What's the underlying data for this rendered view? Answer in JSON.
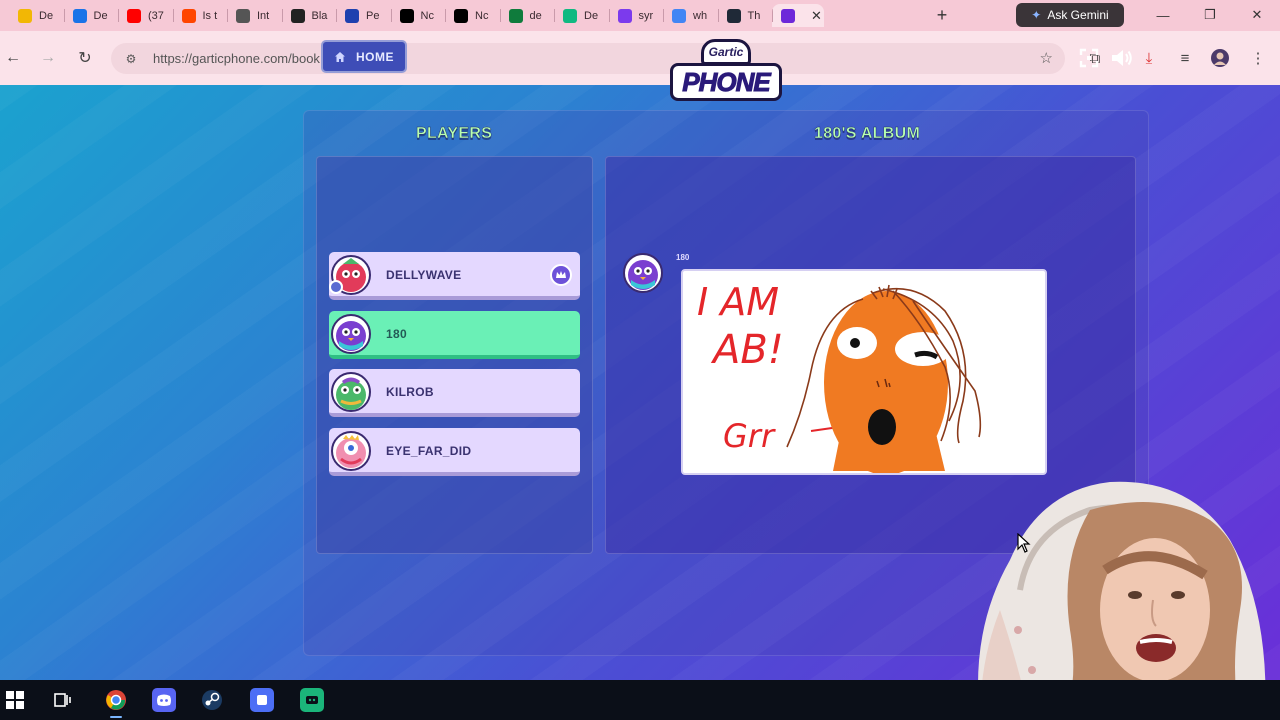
{
  "browser": {
    "tabs": [
      {
        "label": "De",
        "icon": "google-drive-icon",
        "color": "#f2b705"
      },
      {
        "label": "De",
        "icon": "google-drive-icon",
        "color": "#1a73e8"
      },
      {
        "label": "(37",
        "icon": "youtube-icon",
        "color": "#ff0000"
      },
      {
        "label": "Is t",
        "icon": "reddit-icon",
        "color": "#ff4500"
      },
      {
        "label": "Int",
        "icon": "globe-icon",
        "color": "#555555"
      },
      {
        "label": "Bla",
        "icon": "wix-icon",
        "color": "#222222"
      },
      {
        "label": "Pe",
        "icon": "pe-icon",
        "color": "#1e40af"
      },
      {
        "label": "Nc",
        "icon": "x-icon",
        "color": "#000000"
      },
      {
        "label": "Nc",
        "icon": "x-icon",
        "color": "#000000"
      },
      {
        "label": "de",
        "icon": "green-doc-icon",
        "color": "#0f7b3c"
      },
      {
        "label": "De",
        "icon": "k-icon",
        "color": "#10b981"
      },
      {
        "label": "syr",
        "icon": "peace-icon",
        "color": "#7c3aed"
      },
      {
        "label": "wh",
        "icon": "google-icon",
        "color": "#4285f4"
      },
      {
        "label": "Th",
        "icon": "dark-icon",
        "color": "#1f2937"
      },
      {
        "label": "",
        "icon": "gartic-icon",
        "color": "#6d28d9"
      }
    ],
    "gemini_label": "Ask Gemini",
    "url": "https://garticphone.com/book"
  },
  "game": {
    "home_label": "HOME",
    "logo_top": "Gartic",
    "logo_main": "PHONE",
    "players_title": "PLAYERS",
    "album_title": "180'S ALBUM",
    "players": [
      {
        "name": "DELLYWAVE",
        "host": true,
        "active": false,
        "avatar_color": "#e23b5a"
      },
      {
        "name": "180",
        "host": false,
        "active": true,
        "avatar_color": "#7a3fd0"
      },
      {
        "name": "KILROB",
        "host": false,
        "active": false,
        "avatar_color": "#4bb86a"
      },
      {
        "name": "EYE_FAR_DID",
        "host": false,
        "active": false,
        "avatar_color": "#e05a8a"
      }
    ],
    "album_author": "180",
    "drawing_text_line1": "I AM",
    "drawing_text_line2": "AB!",
    "drawing_text_line3": "Grr"
  },
  "colors": {
    "accent_green": "#6af0b6",
    "title_green": "#b8ffb0",
    "card_lilac": "#e4d8ff"
  }
}
